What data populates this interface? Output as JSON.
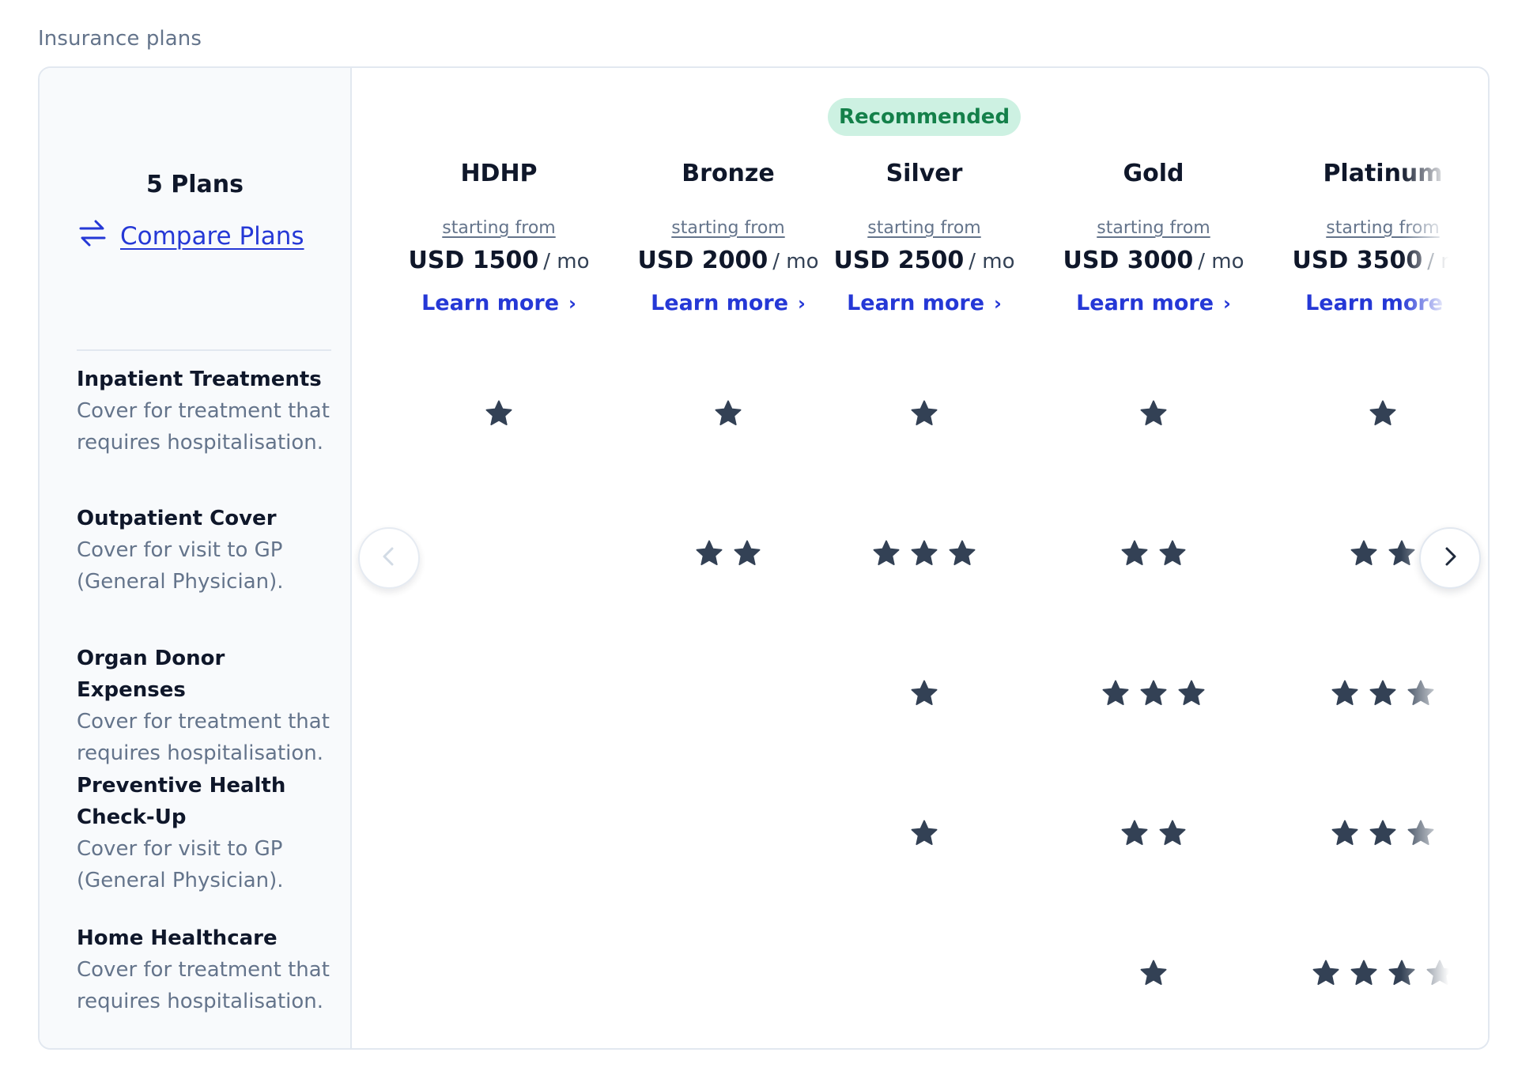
{
  "page": {
    "title": "Insurance plans"
  },
  "sidebar": {
    "plans_count": "5 Plans",
    "compare_label": "Compare Plans"
  },
  "badge": "Recommended",
  "plans": [
    {
      "name": "HDHP",
      "starting": "starting from",
      "price": "USD 1500",
      "per": "/ mo",
      "learn": "Learn more",
      "chevron": "›",
      "ratings": [
        1,
        0,
        0,
        0,
        0
      ]
    },
    {
      "name": "Bronze",
      "starting": "starting from",
      "price": "USD 2000",
      "per": "/ mo",
      "learn": "Learn more",
      "chevron": "›",
      "ratings": [
        1,
        2,
        0,
        0,
        0
      ]
    },
    {
      "name": "Silver",
      "starting": "starting from",
      "price": "USD 2500",
      "per": "/ mo",
      "learn": "Learn more",
      "chevron": "›",
      "ratings": [
        1,
        3,
        1,
        1,
        0
      ]
    },
    {
      "name": "Gold",
      "starting": "starting from",
      "price": "USD 3000",
      "per": "/ mo",
      "learn": "Learn more",
      "chevron": "›",
      "ratings": [
        1,
        2,
        3,
        2,
        1
      ]
    },
    {
      "name": "Platinum",
      "starting": "starting from",
      "price": "USD 3500",
      "per": "/ mo",
      "learn": "Learn more",
      "chevron": "›",
      "ratings": [
        1,
        2,
        3,
        3,
        4
      ]
    }
  ],
  "features": [
    {
      "name": "Inpatient Treatments",
      "desc": "Cover for treatment that requires hospitalisation."
    },
    {
      "name": "Outpatient Cover",
      "desc": "Cover for visit to GP (General Physician)."
    },
    {
      "name": "Organ Donor Expenses",
      "desc": "Cover for treatment that requires hospitalisation."
    },
    {
      "name": "Preventive Health Check-Up",
      "desc": "Cover for visit to GP (General Physician)."
    },
    {
      "name": "Home Healthcare",
      "desc": "Cover for treatment that requires hospitalisation."
    }
  ],
  "icons": {
    "compare": "swap-arrows-icon",
    "rating": "star-icon",
    "prev": "chevron-left-icon",
    "next": "chevron-right-icon"
  },
  "colors": {
    "accent": "#2538d6",
    "star": "#334155",
    "badge_bg": "#cdf1e2",
    "badge_text": "#14804a",
    "panel_bg": "#f8fafc"
  }
}
